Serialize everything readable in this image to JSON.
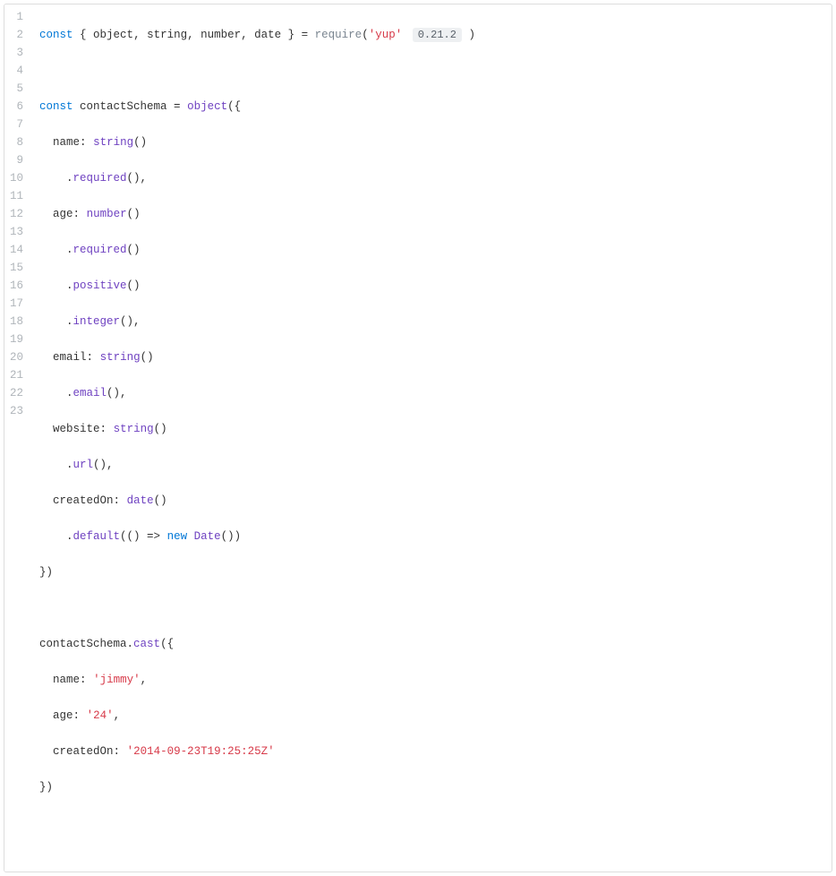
{
  "code": {
    "package": "'yup'",
    "version": "0.21.2",
    "lines": {
      "l3": "const contactSchema = object({",
      "l16": "})",
      "l18": "contactSchema.cast({",
      "l22": "})"
    },
    "schema": {
      "name_key": "name",
      "age_key": "age",
      "email_key": "email",
      "website_key": "website",
      "createdOn_key": "createdOn"
    },
    "cast": {
      "name_key": "name",
      "name_val": "'jimmy'",
      "age_key": "age",
      "age_val": "'24'",
      "createdOn_key": "createdOn",
      "createdOn_val": "'2014-09-23T19:25:25Z'"
    },
    "tokens": {
      "const": "const",
      "require": "require",
      "new": "new",
      "Date": "Date",
      "object": "object",
      "string": "string",
      "number": "number",
      "date": "date",
      "required": "required",
      "positive": "positive",
      "integer": "integer",
      "email": "email",
      "url": "url",
      "default": "default",
      "cast": "cast"
    },
    "lineNumbers": [
      "1",
      "2",
      "3",
      "4",
      "5",
      "6",
      "7",
      "8",
      "9",
      "10",
      "11",
      "12",
      "13",
      "14",
      "15",
      "16",
      "17",
      "18",
      "19",
      "20",
      "21",
      "22",
      "23"
    ]
  }
}
